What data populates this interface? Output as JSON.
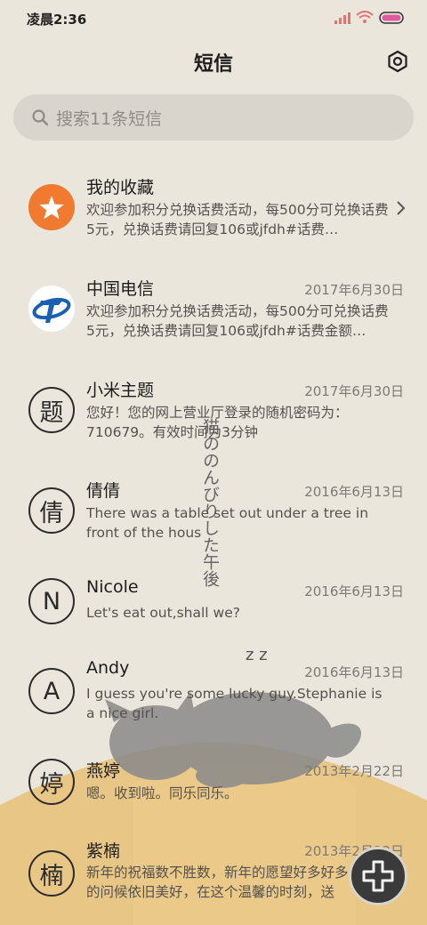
{
  "status": {
    "time": "凌晨2:36"
  },
  "header": {
    "title": "短信"
  },
  "search": {
    "placeholder": "搜索11条短信"
  },
  "conversations": [
    {
      "name": "我的收藏",
      "date": "",
      "preview": "欢迎参加积分兑换话费活动，每500分可兑换话费5元，兑换话费请回复106或jfdh#话费…",
      "avatar": "star"
    },
    {
      "name": "中国电信",
      "date": "2017年6月30日",
      "preview": "欢迎参加积分兑换话费活动，每500分可兑换话费5元，兑换话费请回复106或jfdh#话费金额…",
      "avatar": "telecom-logo"
    },
    {
      "name": "小米主题",
      "date": "2017年6月30日",
      "preview": "您好！您的网上营业厅登录的随机密码为：710679。有效时间为3分钟",
      "avatar": "题"
    },
    {
      "name": "倩倩",
      "date": "2016年6月13日",
      "preview": "There was a table set out under a tree in front of the hous",
      "avatar": "倩"
    },
    {
      "name": "Nicole",
      "date": "2016年6月13日",
      "preview": "Let's eat out,shall we?",
      "avatar": "N"
    },
    {
      "name": "Andy",
      "date": "2016年6月13日",
      "preview": "I guess you're some lucky guy.Stephanie is a nice girl.",
      "avatar": "A"
    },
    {
      "name": "燕婷",
      "date": "2013年2月22日",
      "preview": "嗯。收到啦。同乐同乐。",
      "avatar": "婷"
    },
    {
      "name": "紫楠",
      "date": "2013年2月22日",
      "preview": "新年的祝福数不胜数，新年的愿望好多好多，新年的问候依旧美好，在这个温馨的时刻，送",
      "avatar": "楠"
    }
  ],
  "wallpaper": {
    "vertical_text": "猫ののんびりした午後",
    "sleep": "z z"
  },
  "colors": {
    "accent_orange": "#f07a30",
    "telecom_blue": "#1a5fb4",
    "background": "#ebe6dc"
  }
}
